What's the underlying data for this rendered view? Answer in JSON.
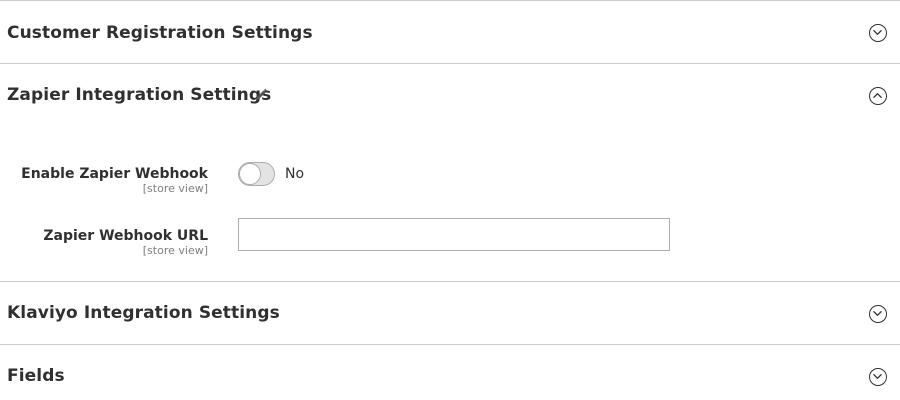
{
  "sections": [
    {
      "id": "customer-registration",
      "title": "Customer Registration Settings",
      "expanded": false
    },
    {
      "id": "zapier-integration",
      "title": "Zapier Integration Settings",
      "expanded": true,
      "fields": {
        "enable_webhook": {
          "label": "Enable Zapier Webhook",
          "scope": "[store view]",
          "value_text": "No",
          "enabled": false
        },
        "webhook_url": {
          "label": "Zapier Webhook URL",
          "scope": "[store view]",
          "value": "",
          "placeholder": ""
        }
      }
    },
    {
      "id": "klaviyo-integration",
      "title": "Klaviyo Integration Settings",
      "expanded": false
    },
    {
      "id": "fields",
      "title": "Fields",
      "expanded": false
    }
  ],
  "icons": {
    "collapsed": "chevron-down-circle-icon",
    "expanded": "chevron-up-circle-icon",
    "edit": "pencil-icon"
  },
  "colors": {
    "text": "#303030",
    "muted": "#808080",
    "border": "#adadad",
    "divider": "#cccccc",
    "toggle_off": "#e3e3e3"
  }
}
